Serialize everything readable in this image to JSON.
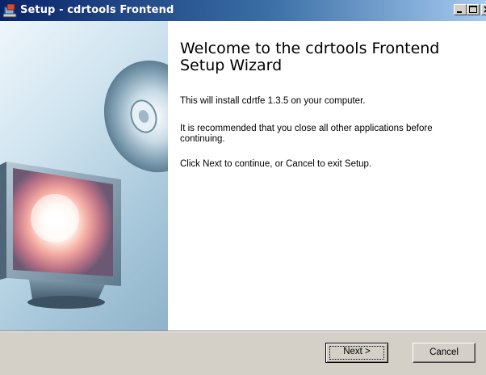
{
  "window": {
    "title": "Setup - cdrtools Frontend"
  },
  "title_buttons": {
    "minimize": "minimize-icon",
    "maximize": "maximize-icon",
    "close": "close-icon"
  },
  "wizard": {
    "heading": "Welcome to the cdrtools Frontend Setup Wizard",
    "paragraphs": [
      "This will install cdrtfe 1.3.5 on your computer.",
      "It is recommended that you close all other applications before continuing.",
      "Click Next to continue, or Cancel to exit Setup."
    ]
  },
  "buttons": {
    "next_label": "Next >",
    "cancel_label": "Cancel"
  },
  "colors": {
    "titlebar_start": "#0a246a",
    "titlebar_end": "#a6caf0",
    "dialog_face": "#d4d0c8",
    "content_bg": "#ffffff"
  }
}
